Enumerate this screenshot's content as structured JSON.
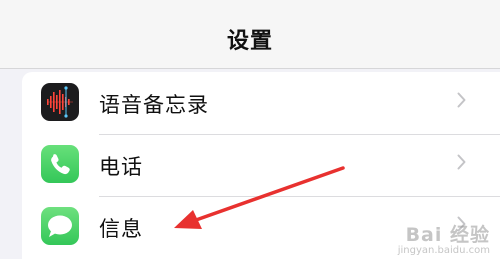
{
  "header": {
    "title": "设置"
  },
  "settings": {
    "items": [
      {
        "label": "语音备忘录",
        "icon": "voice-memos-icon"
      },
      {
        "label": "电话",
        "icon": "phone-icon"
      },
      {
        "label": "信息",
        "icon": "messages-icon"
      }
    ]
  },
  "colors": {
    "background": "#f2f2f7",
    "green_icon": "#34c759",
    "arrow": "#e8312f",
    "chevron": "#c4c4c7"
  },
  "watermark": {
    "logo": "Bai 经验",
    "url": "jingyan.baidu.com"
  }
}
